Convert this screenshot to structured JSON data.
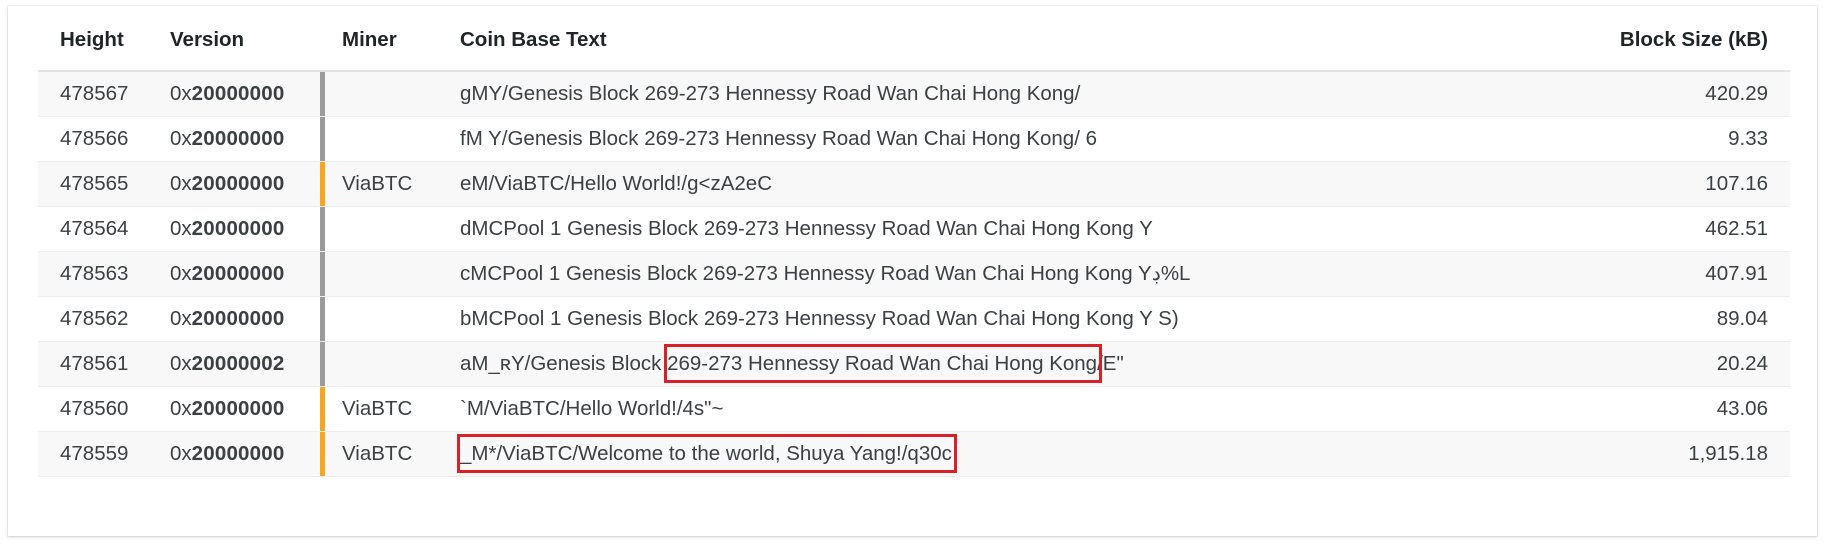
{
  "table": {
    "columns": [
      {
        "key": "height",
        "label": "Height"
      },
      {
        "key": "version",
        "label": "Version"
      },
      {
        "key": "miner",
        "label": "Miner"
      },
      {
        "key": "coinbase",
        "label": "Coin Base Text"
      },
      {
        "key": "size",
        "label": "Block Size (kB)"
      }
    ],
    "rows": [
      {
        "height": "478567",
        "version_prefix": "0x",
        "version_body": "20000000",
        "miner": "",
        "miner_bar": "grey",
        "coinbase": "gMY/Genesis Block 269-273 Hennessy Road Wan Chai Hong Kong/",
        "size": "420.29"
      },
      {
        "height": "478566",
        "version_prefix": "0x",
        "version_body": "20000000",
        "miner": "",
        "miner_bar": "grey",
        "coinbase": "fM Y/Genesis Block 269-273 Hennessy Road Wan Chai Hong Kong/ 6",
        "size": "9.33"
      },
      {
        "height": "478565",
        "version_prefix": "0x",
        "version_body": "20000000",
        "miner": "ViaBTC",
        "miner_bar": "orange",
        "coinbase": "eM/ViaBTC/Hello World!/g<zA2eC",
        "size": "107.16"
      },
      {
        "height": "478564",
        "version_prefix": "0x",
        "version_body": "20000000",
        "miner": "",
        "miner_bar": "grey",
        "coinbase": "dMCPool 1 Genesis Block 269-273 Hennessy Road Wan Chai Hong Kong Y",
        "size": "462.51"
      },
      {
        "height": "478563",
        "version_prefix": "0x",
        "version_body": "20000000",
        "miner": "",
        "miner_bar": "grey",
        "coinbase": "cMCPool 1 Genesis Block 269-273 Hennessy Road Wan Chai Hong Kong Yڊ%L",
        "size": "407.91"
      },
      {
        "height": "478562",
        "version_prefix": "0x",
        "version_body": "20000000",
        "miner": "",
        "miner_bar": "grey",
        "coinbase": "bMCPool 1 Genesis Block 269-273 Hennessy Road Wan Chai Hong Kong Y S)",
        "size": "89.04"
      },
      {
        "height": "478561",
        "version_prefix": "0x",
        "version_body": "20000002",
        "miner": "",
        "miner_bar": "grey",
        "coinbase": "aM_ʀY/Genesis Block 269-273 Hennessy Road Wan Chai Hong Kong/E\"",
        "size": "20.24"
      },
      {
        "height": "478560",
        "version_prefix": "0x",
        "version_body": "20000000",
        "miner": "ViaBTC",
        "miner_bar": "orange",
        "coinbase": "`M/ViaBTC/Hello World!/4s\"~",
        "size": "43.06"
      },
      {
        "height": "478559",
        "version_prefix": "0x",
        "version_body": "20000000",
        "miner": "ViaBTC",
        "miner_bar": "orange",
        "coinbase": "_M*/ViaBTC/Welcome to the world, Shuya Yang!/q30c",
        "size": "1,915.18"
      }
    ]
  },
  "annotations": {
    "highlight_color": "#d62128",
    "boxes": [
      {
        "label": "269-273 Hennessy Road Wan Chai Hong Kong",
        "row_height": "478561"
      },
      {
        "label": "_M*/ViaBTC/Welcome to the world, Shuya Yang!/q30c",
        "row_height": "478559"
      }
    ]
  }
}
